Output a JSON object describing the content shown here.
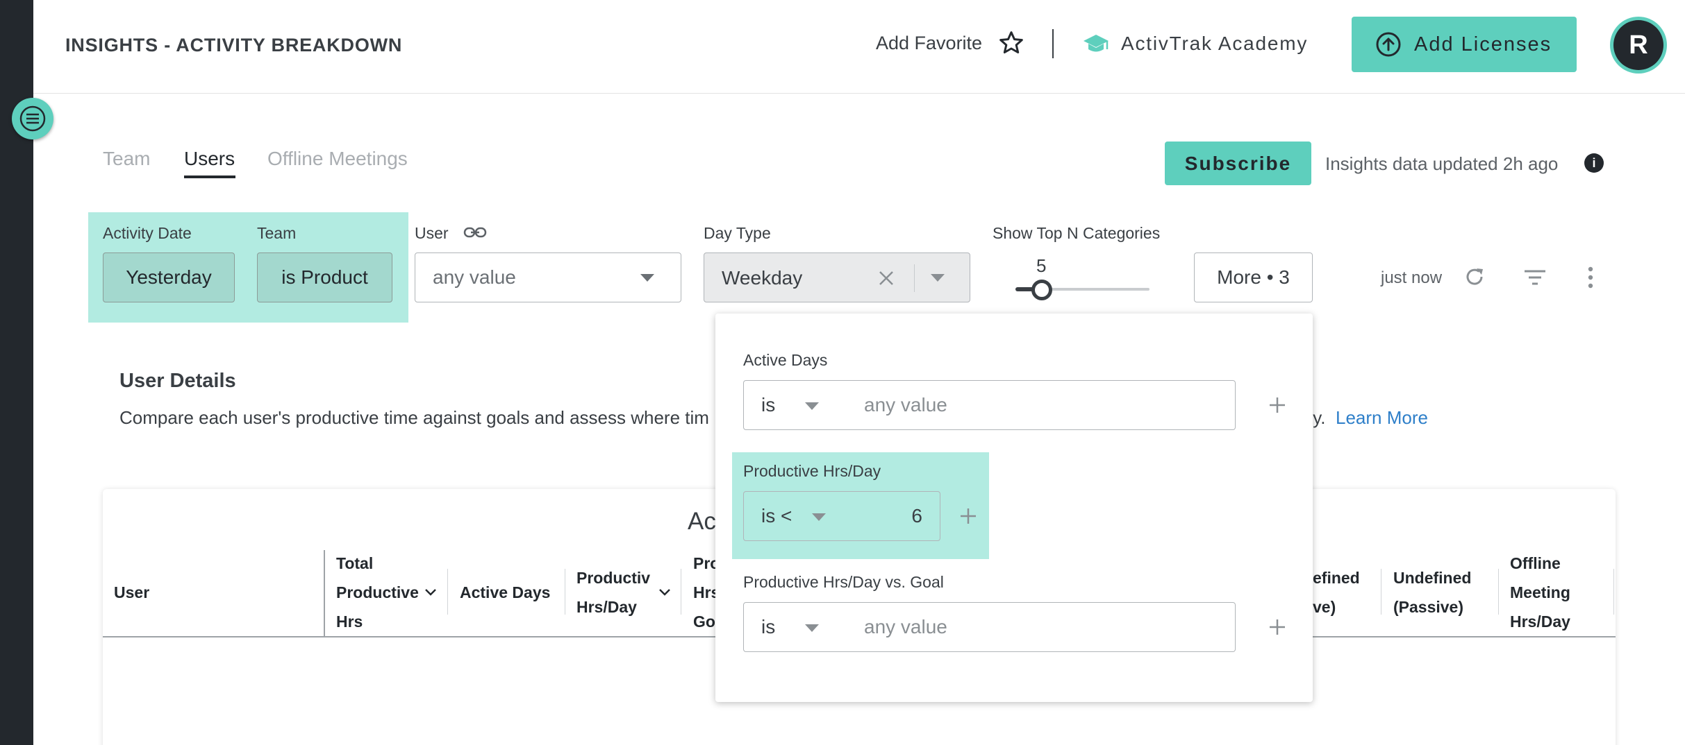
{
  "header": {
    "title": "INSIGHTS - ACTIVITY BREAKDOWN",
    "add_favorite": "Add Favorite",
    "academy": "ActivTrak Academy",
    "add_licenses": "Add Licenses",
    "avatar_initial": "R"
  },
  "tabs": [
    {
      "label": "Team",
      "active": false
    },
    {
      "label": "Users",
      "active": true
    },
    {
      "label": "Offline Meetings",
      "active": false
    }
  ],
  "subscribe_label": "Subscribe",
  "updated_text": "Insights data updated 2h ago",
  "filters": {
    "activity_date": {
      "label": "Activity Date",
      "value": "Yesterday"
    },
    "team": {
      "label": "Team",
      "value": "is Product"
    },
    "user": {
      "label": "User",
      "placeholder": "any value"
    },
    "day_type": {
      "label": "Day Type",
      "value": "Weekday"
    },
    "top_n": {
      "label": "Show Top N Categories",
      "value": "5"
    },
    "more_label": "More • 3",
    "refresh_text": "just now"
  },
  "details": {
    "title": "User Details",
    "description": "Compare each user's productive time against goals and assess where tim",
    "description_tail": "ty.",
    "learn_more": "Learn More"
  },
  "table": {
    "title": "Ac",
    "headers": {
      "user": "User",
      "total_productive_hrs": [
        "Total",
        "Productive",
        "Hrs"
      ],
      "active_days": "Active Days",
      "productive_hrs_day": [
        "Productiv",
        "Hrs/Day"
      ],
      "pro_hrs_goal": [
        "Pro",
        "Hrs",
        "Go"
      ],
      "undefined_active": [
        "efined",
        "ve)"
      ],
      "undefined_passive": [
        "Undefined",
        "(Passive)"
      ],
      "offline_meeting": [
        "Offline",
        "Meeting",
        "Hrs/Day"
      ]
    }
  },
  "more_panel": {
    "active_days": {
      "label": "Active Days",
      "operator": "is",
      "placeholder": "any value"
    },
    "productive_hrs_day": {
      "label": "Productive Hrs/Day",
      "operator": "is <",
      "value": "6"
    },
    "productive_vs_goal": {
      "label": "Productive Hrs/Day vs. Goal",
      "operator": "is",
      "placeholder": "any value"
    }
  },
  "colors": {
    "accent": "#5ecfbd",
    "highlight": "#b2ebe1",
    "rail": "#23282d",
    "link": "#2e7fc9"
  }
}
